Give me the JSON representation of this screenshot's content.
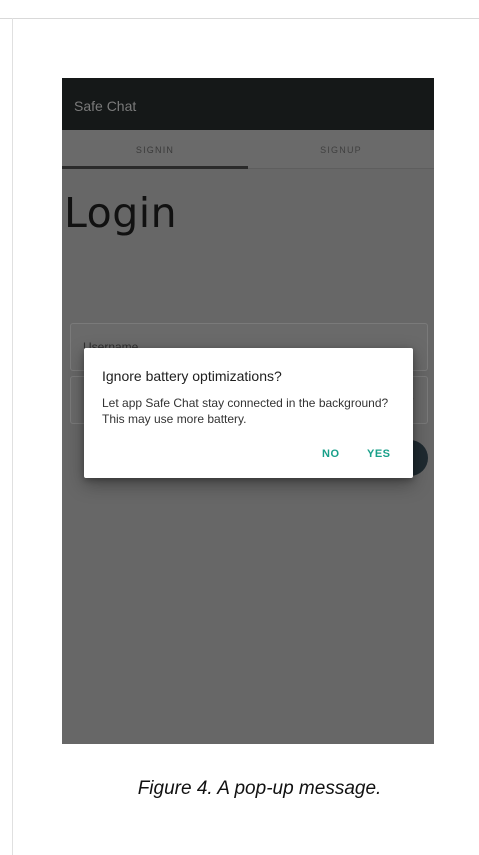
{
  "app": {
    "title": "Safe Chat"
  },
  "tabs": [
    {
      "label": "SIGNIN",
      "selected": true
    },
    {
      "label": "SIGNUP",
      "selected": false
    }
  ],
  "login": {
    "heading": "Login",
    "username_placeholder": "Username"
  },
  "dialog": {
    "title": "Ignore battery optimizations?",
    "message": "Let app Safe Chat stay connected in the background? This may use more battery.",
    "no_label": "NO",
    "yes_label": "YES"
  },
  "caption": "Figure 4. A pop-up message.",
  "colors": {
    "app_bar": "#151818",
    "scrim_background": "#676767",
    "dialog_button": "#19a08a"
  }
}
